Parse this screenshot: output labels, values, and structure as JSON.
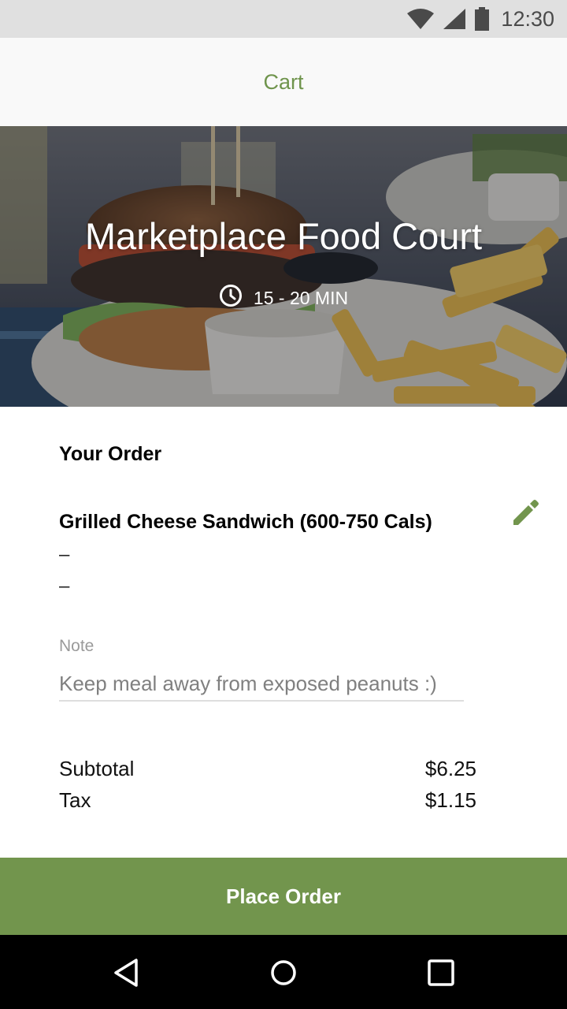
{
  "status_bar": {
    "time": "12:30"
  },
  "app_bar": {
    "title": "Cart"
  },
  "hero": {
    "title": "Marketplace Food Court",
    "time_estimate": "15 - 20 MIN"
  },
  "order": {
    "section_title": "Your Order",
    "item": {
      "name": "Grilled Cheese Sandwich (600-750 Cals)",
      "line_1": "–",
      "line_2": "–"
    },
    "note": {
      "label": "Note",
      "value": "Keep meal away from exposed peanuts :)"
    },
    "summary": [
      {
        "label": "Subtotal",
        "amount": "$6.25"
      },
      {
        "label": "Tax",
        "amount": "$1.15"
      }
    ]
  },
  "actions": {
    "place_order_label": "Place Order"
  },
  "icons": {
    "wifi": "wifi-icon",
    "signal": "signal-icon",
    "battery": "battery-icon",
    "clock": "clock-icon",
    "edit": "pencil-icon",
    "back": "back-triangle-icon",
    "home": "home-circle-icon",
    "recents": "recents-square-icon"
  },
  "colors": {
    "accent": "#72954d",
    "title_green": "#6f944c",
    "status_bar": "#e0e0e0",
    "nav_bar": "#000000"
  }
}
